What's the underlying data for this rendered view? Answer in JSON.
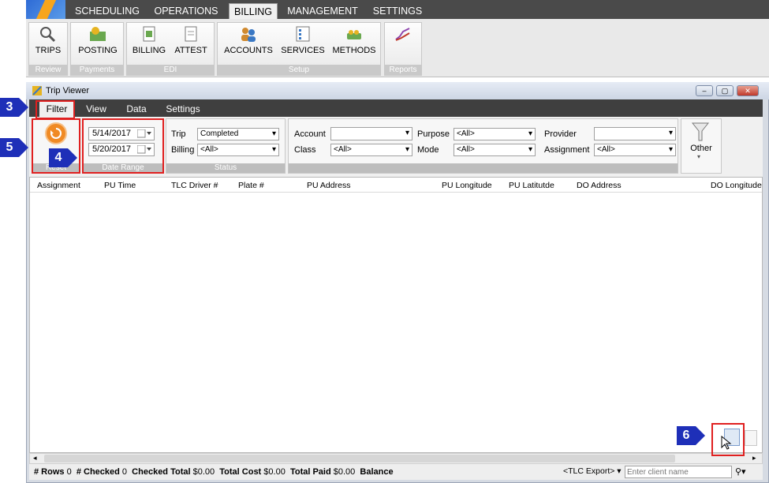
{
  "app_tabs": [
    "SCHEDULING",
    "OPERATIONS",
    "BILLING",
    "MANAGEMENT",
    "SETTINGS"
  ],
  "ribbon": {
    "buttons": [
      "TRIPS",
      "POSTING",
      "BILLING",
      "ATTEST",
      "ACCOUNTS",
      "SERVICES",
      "METHODS"
    ],
    "groups": [
      "Review",
      "Payments",
      "EDI",
      "Setup",
      "Reports"
    ]
  },
  "window": {
    "title": "Trip Viewer"
  },
  "sub_tabs": [
    "Filter",
    "View",
    "Data",
    "Settings"
  ],
  "filter": {
    "reset_label": "Reset",
    "date_start": "5/14/2017",
    "date_end": "5/20/2017",
    "date_range_label": "Date Range",
    "trip_label": "Trip",
    "trip_value": "Completed",
    "billing_label": "Billing",
    "billing_value": "<All>",
    "status_label": "Status",
    "account_label": "Account",
    "account_value": "",
    "class_label": "Class",
    "class_value": "<All>",
    "purpose_label": "Purpose",
    "purpose_value": "<All>",
    "mode_label": "Mode",
    "mode_value": "<All>",
    "provider_label": "Provider",
    "provider_value": "",
    "assignment_label": "Assignment",
    "assignment_value": "<All>",
    "other_label": "Other"
  },
  "grid": {
    "columns": [
      "Assignment",
      "PU Time",
      "TLC Driver #",
      "Plate #",
      "PU Address",
      "PU Longitude",
      "PU Latitutde",
      "DO Address",
      "DO Longitude"
    ]
  },
  "status": {
    "rows_label": "# Rows",
    "rows": "0",
    "checked_label": "# Checked",
    "checked": "0",
    "checked_total_label": "Checked Total",
    "checked_total": "$0.00",
    "total_cost_label": "Total Cost",
    "total_cost": "$0.00",
    "total_paid_label": "Total Paid",
    "total_paid": "$0.00",
    "balance_label": "Balance",
    "export_label": "<TLC Export>",
    "client_placeholder": "Enter client name"
  },
  "callouts": [
    "3",
    "4",
    "5",
    "6"
  ],
  "colors": {
    "callout": "#1e2fb8",
    "highlight": "#e02020",
    "tabbar": "#3f3f3f"
  }
}
